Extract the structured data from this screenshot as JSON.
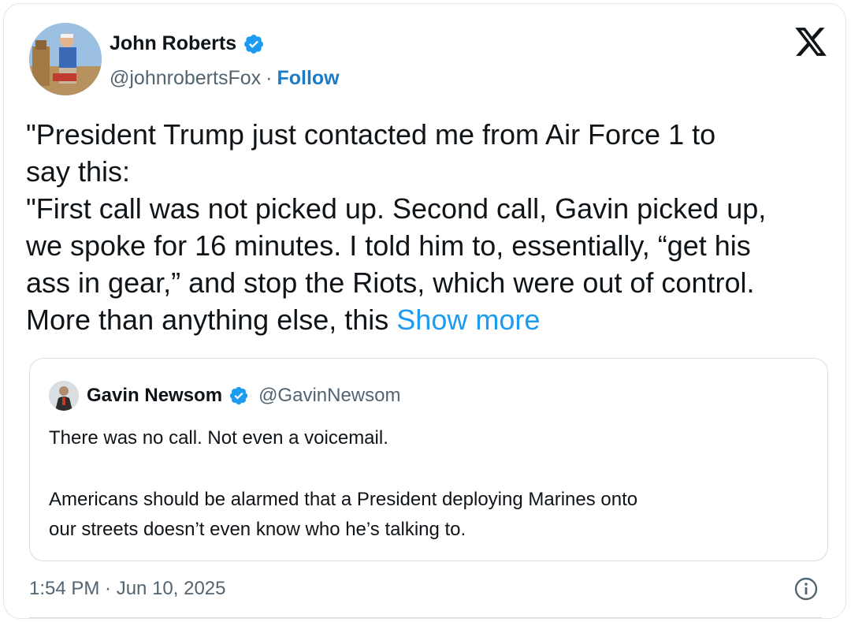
{
  "author": {
    "name": "John Roberts",
    "handle": "@johnrobertsFox",
    "separator": "·",
    "follow_label": "Follow",
    "verified": true
  },
  "tweet": {
    "lines": [
      "\"President Trump just contacted me from Air Force 1 to",
      "say this:",
      "\"First call was not picked up. Second call, Gavin picked up,",
      "we spoke for 16 minutes. I told him to, essentially, “get his",
      "ass in gear,” and stop the Riots, which were out of control."
    ],
    "last_line": "More than anything else, this ",
    "show_more_label": "Show more"
  },
  "quote": {
    "name": "Gavin Newsom",
    "handle": "@GavinNewsom",
    "verified": true,
    "paragraph1": "There was no call. Not even a voicemail.",
    "paragraph2_line1": "Americans should be alarmed that a President deploying Marines onto",
    "paragraph2_line2": "our streets doesn’t even know who he’s talking to."
  },
  "meta": {
    "timestamp": "1:54 PM · Jun 10, 2025"
  },
  "icons": {
    "platform": "x-logo-icon",
    "verified": "verified-badge-icon",
    "info": "info-icon"
  },
  "colors": {
    "link": "#1d9bf0",
    "follow": "#1d7bc6",
    "verified": "#1d9bf0",
    "secondary_text": "#536471"
  }
}
